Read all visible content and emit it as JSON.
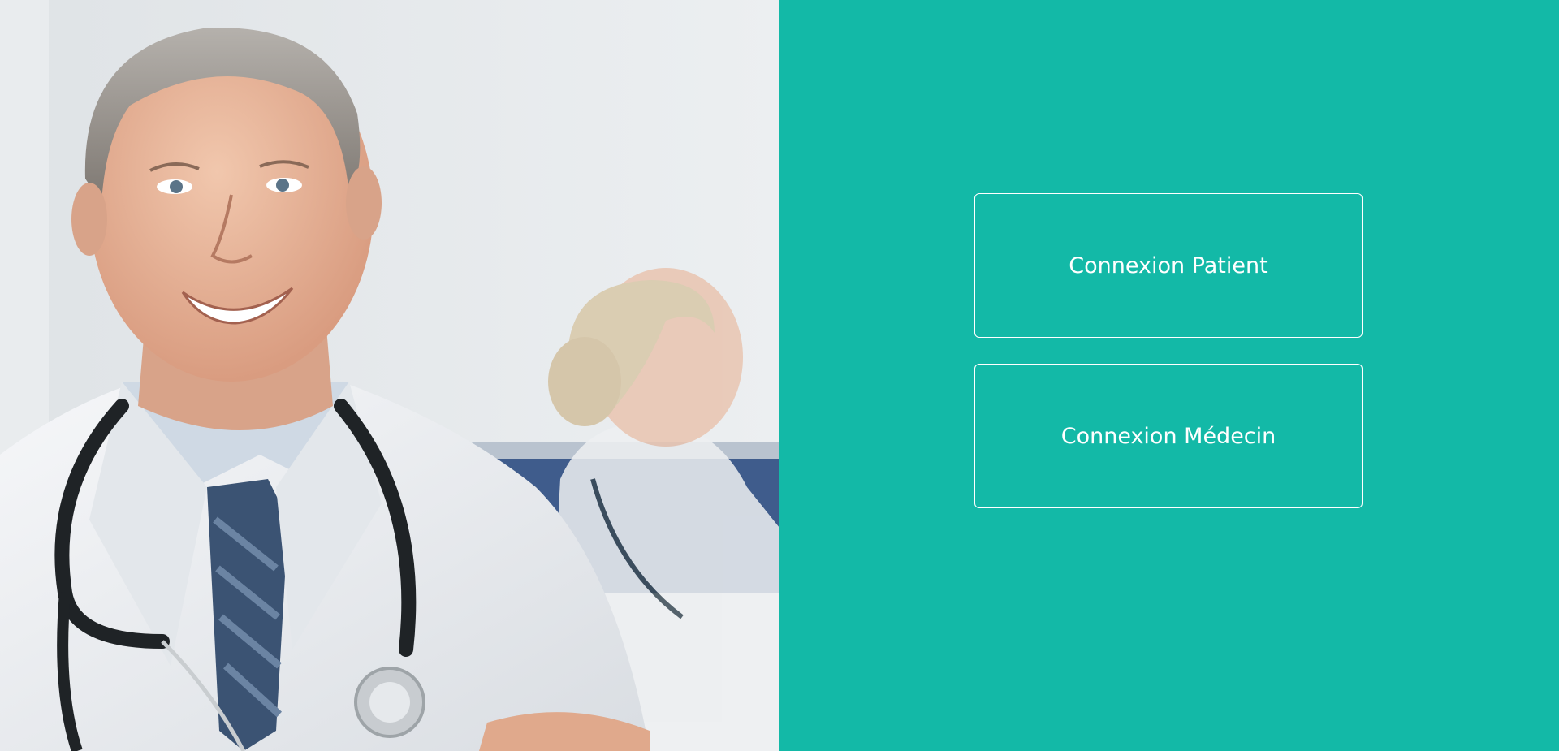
{
  "photo": {
    "subject": "doctor-photo"
  },
  "login": {
    "patient_label": "Connexion Patient",
    "medecin_label": "Connexion Médecin"
  },
  "colors": {
    "panel_background": "#13b9a7",
    "button_border": "#ffffff",
    "button_text": "#ffffff"
  }
}
